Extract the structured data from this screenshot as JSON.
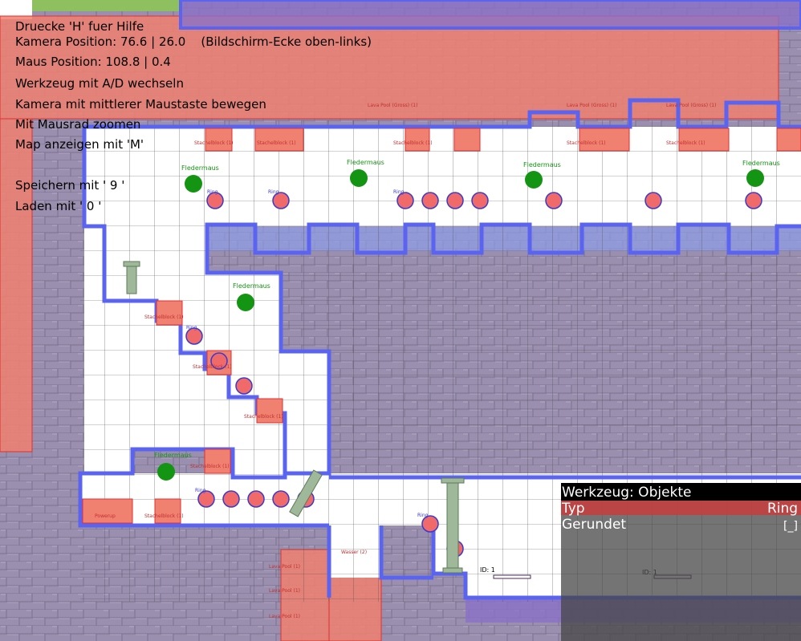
{
  "hud": {
    "help": "Druecke 'H' fuer Hilfe",
    "camera": "Kamera Position: 76.6 | 26.0    (Bildschirm-Ecke oben-links)",
    "mouse": "Maus Position: 108.8 | 0.4",
    "tool_switch": "Werkzeug mit A/D wechseln",
    "camera_move": "Kamera mit mittlerer Maustaste bewegen",
    "zoom": "Mit Mausrad zoomen",
    "map": "Map anzeigen mit 'M'",
    "save": "Speichern mit ' 9 '",
    "load": "Laden mit ' 0 '"
  },
  "tool_panel": {
    "title": "Werkzeug: Objekte",
    "type_label": "Typ",
    "type_value": "Ring",
    "rounded_label": "Gerundet",
    "rounded_value": "[_]"
  },
  "entities": {
    "bat_label": "Fledermaus",
    "ring_label": "Ring",
    "spike_label": "Stachelblock (1)",
    "lava_label": "Lava Pool (1)",
    "lava_big_label": "Lava Pool (Gross) (1)",
    "water_label": "Wasser (2)",
    "powerup_label": "Powerup",
    "id_label": "ID: 1"
  },
  "colors": {
    "stone": "#9a8fae",
    "lava": "#f08070",
    "outline": "#5a64f0",
    "bat": "#139413",
    "ring": "#f06a6a",
    "grid": "#555555"
  }
}
